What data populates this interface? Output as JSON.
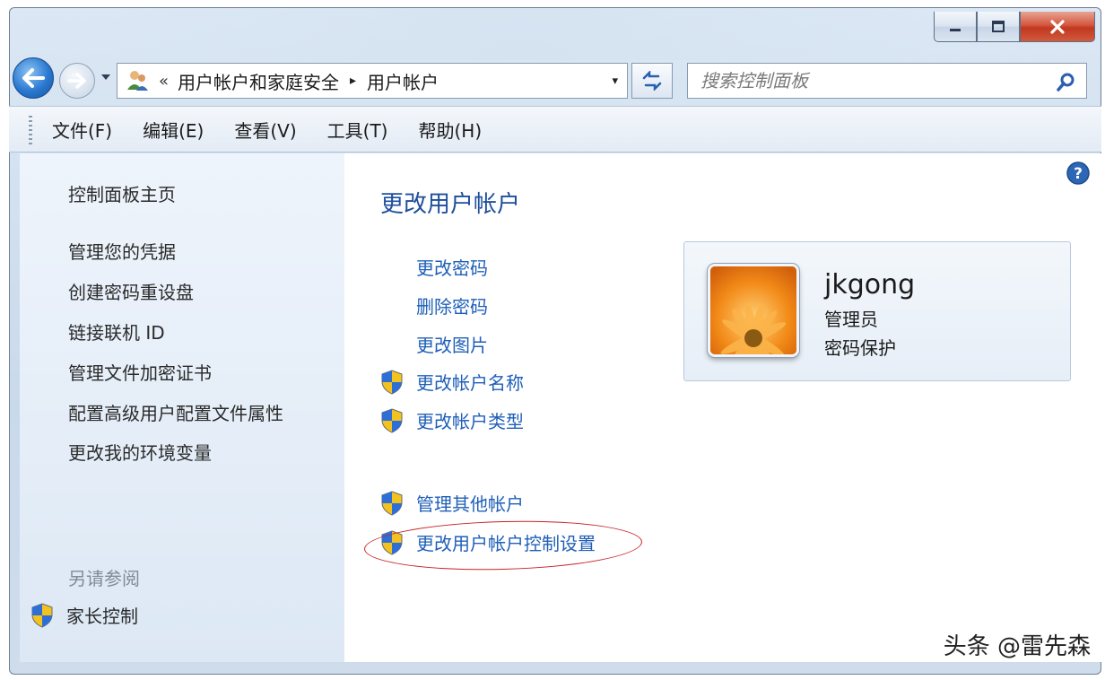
{
  "window": {
    "caption_buttons": {
      "minimize_icon": "minimize-icon",
      "maximize_icon": "maximize-icon",
      "close_icon": "close-icon"
    }
  },
  "navigation": {
    "address": {
      "overflow": "«",
      "crumbs": [
        "用户帐户和家庭安全",
        "用户帐户"
      ],
      "separator": "▸",
      "dropdown": "▾"
    },
    "search": {
      "placeholder": "搜索控制面板"
    }
  },
  "menubar": {
    "items": [
      "文件(F)",
      "编辑(E)",
      "查看(V)",
      "工具(T)",
      "帮助(H)"
    ]
  },
  "sidebar": {
    "links": [
      "控制面板主页",
      "管理您的凭据",
      "创建密码重设盘",
      "链接联机 ID",
      "管理文件加密证书",
      "配置高级用户配置文件属性",
      "更改我的环境变量"
    ],
    "see_also": "另请参阅",
    "parental_control": "家长控制"
  },
  "main": {
    "title": "更改用户帐户",
    "tasks": [
      {
        "label": "更改密码",
        "shield": false
      },
      {
        "label": "删除密码",
        "shield": false
      },
      {
        "label": "更改图片",
        "shield": false
      },
      {
        "label": "更改帐户名称",
        "shield": true
      },
      {
        "label": "更改帐户类型",
        "shield": true
      }
    ],
    "other_tasks": [
      {
        "label": "管理其他帐户",
        "shield": true
      },
      {
        "label": "更改用户帐户控制设置",
        "shield": true,
        "highlighted": true
      }
    ]
  },
  "account": {
    "name": "jkgong",
    "role": "管理员",
    "password_status": "密码保护"
  },
  "watermark": "头条 @雷先森",
  "colors": {
    "link_blue": "#1f5fb8",
    "title_blue": "#1e4f9c",
    "highlight_red": "#c8202a"
  }
}
